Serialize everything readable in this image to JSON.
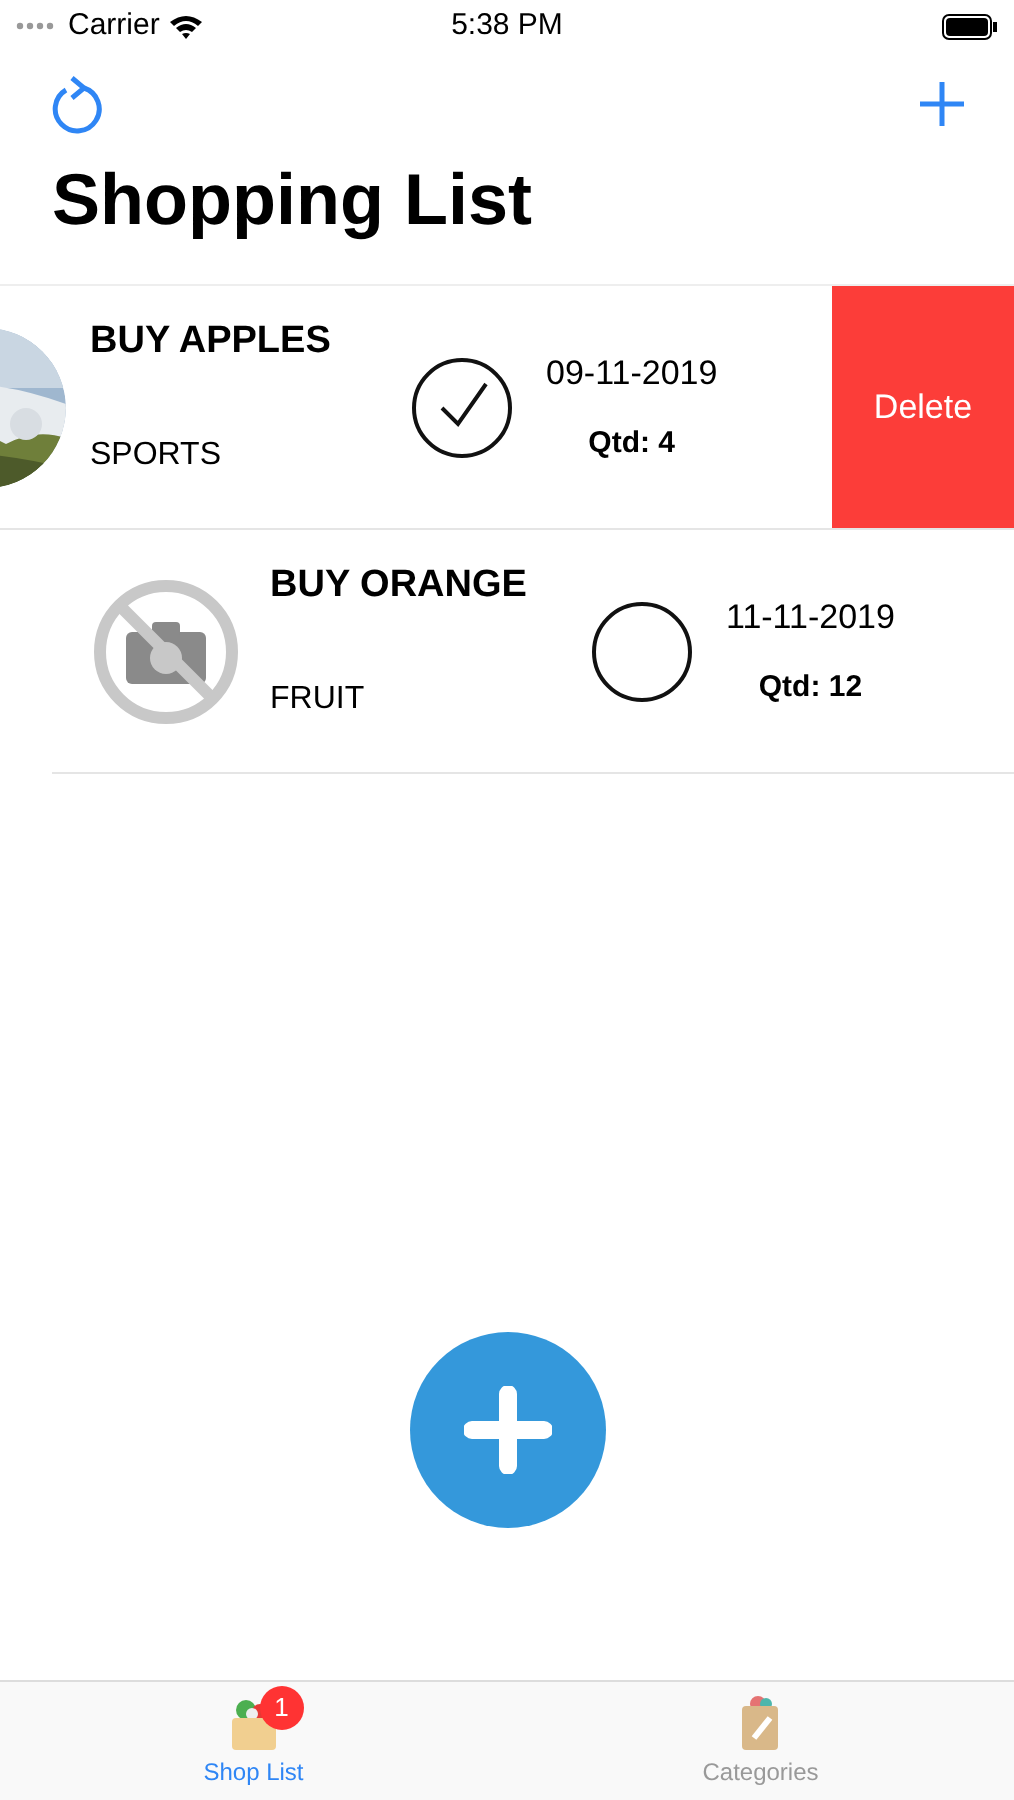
{
  "status_bar": {
    "carrier": "Carrier",
    "time": "5:38 PM"
  },
  "nav": {
    "title": "Shopping List"
  },
  "items": [
    {
      "title": "BUY APPLES",
      "category": "SPORTS",
      "checked": true,
      "date": "09-11-2019",
      "quantity": "Qtd: 4",
      "swiped": true,
      "action": "Delete"
    },
    {
      "kind": "no-photo",
      "title": "BUY ORANGE",
      "category": "FRUIT",
      "checked": false,
      "date": "11-11-2019",
      "quantity": "Qtd: 12",
      "swiped": false
    }
  ],
  "tabs": [
    {
      "kind": "bag",
      "label": "Shop List",
      "selected": true,
      "badge": "1"
    },
    {
      "kind": "clipboard",
      "label": "Categories",
      "selected": false
    }
  ]
}
